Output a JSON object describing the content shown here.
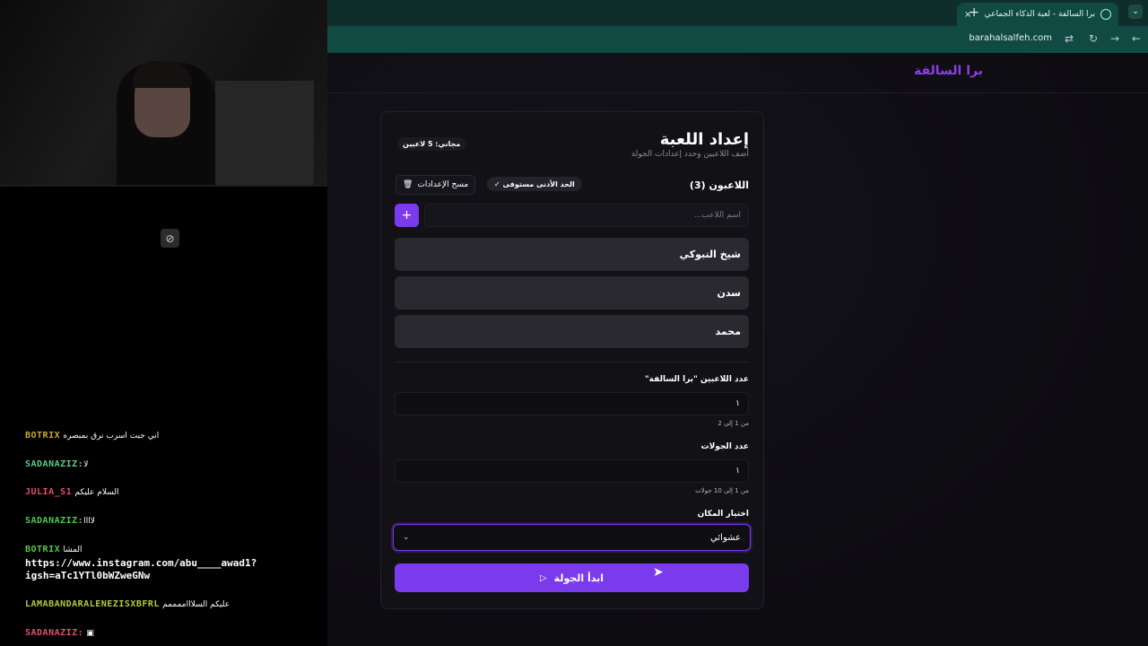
{
  "browser": {
    "tab_title": "برا السالفة - لعبة الذكاء الجماعي",
    "tab_close": "×",
    "new_tab": "+",
    "url": "barahalsalfeh.com"
  },
  "page": {
    "brand": "برا السالفة",
    "title": "إعداد اللعبة",
    "subtitle": "أضف اللاعبين وحدد إعدادات الجولة",
    "free_badge": "مجاني: 5 لاعبين",
    "players_heading": "اللاعبون (3)",
    "min_badge": "الحد الأدنى مستوفى ✓",
    "clear_label": "مسح الإعدادات",
    "add_symbol": "+",
    "name_placeholder": "اسم اللاعب...",
    "players": [
      {
        "name": "شيخ التبوكي"
      },
      {
        "name": "سدن"
      },
      {
        "name": "محمد"
      }
    ],
    "outsiders_label": "عدد اللاعبين \"برا السالفة\"",
    "outsiders_value": "١",
    "outsiders_hint": "من 1 إلى 2",
    "rounds_label": "عدد الجولات",
    "rounds_value": "١",
    "rounds_hint": "من 1 إلى 10 جولات",
    "location_label": "اختيار المكان",
    "location_value": "عشوائي",
    "start_label": "ابدأ الجولة"
  },
  "chat": {
    "messages": [
      {
        "user": "BOTRIX",
        "text": "اني جبت اسرب نرق بمبصره",
        "color": "#c8a92e"
      },
      {
        "user": "SADANAZIZ:",
        "text": "لا",
        "color": "#5ec98f"
      },
      {
        "user": "JULIA_S1",
        "text": "السلام عليكم",
        "color": "#e0506b"
      },
      {
        "user": "SADANAZIZ:",
        "text": "لاااا",
        "color": "#4fc94a"
      },
      {
        "user": "BOTRIX",
        "text": "المشا",
        "color": "#4fc94a"
      },
      {
        "user": "LAMABANDARALENEZISXBFRL",
        "text": "عليكم السلاااممممم",
        "color": "#b6c93a"
      },
      {
        "user": "SADANAZIZ:",
        "text": "",
        "color": "#e0506b"
      }
    ],
    "link": "https://www.instagram.com/abu____awad1?igsh=aTc1YTl0bWZweGNw"
  }
}
